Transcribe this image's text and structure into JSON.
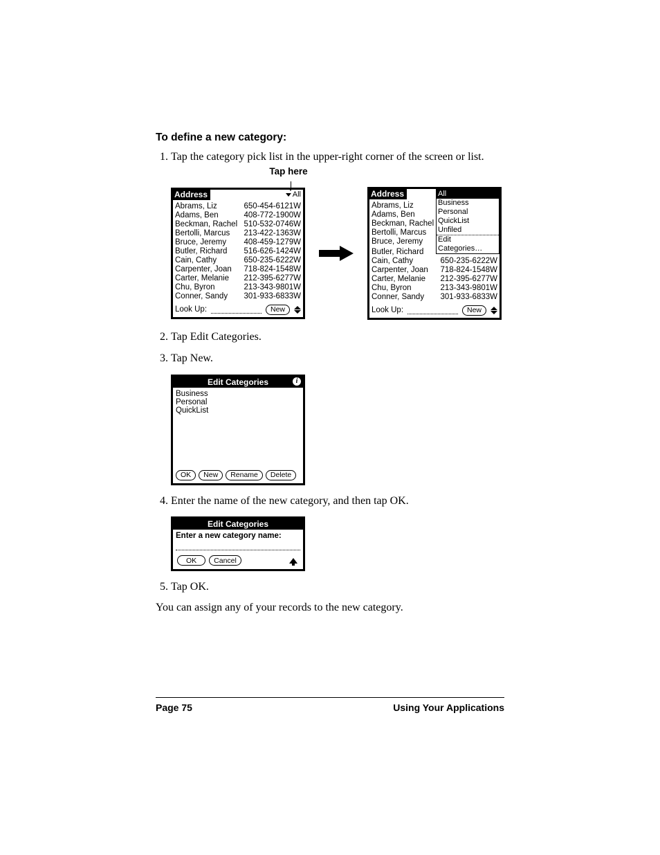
{
  "heading": "To define a new category:",
  "steps": [
    "Tap the category pick list in the upper-right corner of the screen or list.",
    "Tap Edit Categories.",
    "Tap New.",
    "Enter the name of the new category, and then tap OK.",
    "Tap OK."
  ],
  "closing": "You can assign any of your records to the new category.",
  "tap_here": "Tap here",
  "address": {
    "title": "Address",
    "picklist_label": "All",
    "look_up": "Look Up:",
    "new_btn": "New",
    "rows": [
      {
        "name": "Abrams, Liz",
        "phone": "650-454-6121W"
      },
      {
        "name": "Adams, Ben",
        "phone": "408-772-1900W"
      },
      {
        "name": "Beckman, Rachel",
        "phone": "510-532-0746W"
      },
      {
        "name": "Bertolli, Marcus",
        "phone": "213-422-1363W"
      },
      {
        "name": "Bruce, Jeremy",
        "phone": "408-459-1279W"
      },
      {
        "name": "Butler, Richard",
        "phone": "516-626-1424W"
      },
      {
        "name": "Cain, Cathy",
        "phone": "650-235-6222W"
      },
      {
        "name": "Carpenter, Joan",
        "phone": "718-824-1548W"
      },
      {
        "name": "Carter, Melanie",
        "phone": "212-395-6277W"
      },
      {
        "name": "Chu, Byron",
        "phone": "213-343-9801W"
      },
      {
        "name": "Conner, Sandy",
        "phone": "301-933-6833W"
      }
    ]
  },
  "dropdown": {
    "items": [
      "All",
      "Business",
      "Personal",
      "QuickList",
      "Unfiled",
      "Edit Categories…"
    ]
  },
  "dialog1": {
    "title": "Edit Categories",
    "items": [
      "Business",
      "Personal",
      "QuickList"
    ],
    "buttons": {
      "ok": "OK",
      "new": "New",
      "rename": "Rename",
      "delete": "Delete"
    }
  },
  "dialog2": {
    "title": "Edit Categories",
    "prompt": "Enter a new category name:",
    "buttons": {
      "ok": "OK",
      "cancel": "Cancel"
    }
  },
  "footer": {
    "left": "Page 75",
    "right": "Using Your Applications"
  }
}
